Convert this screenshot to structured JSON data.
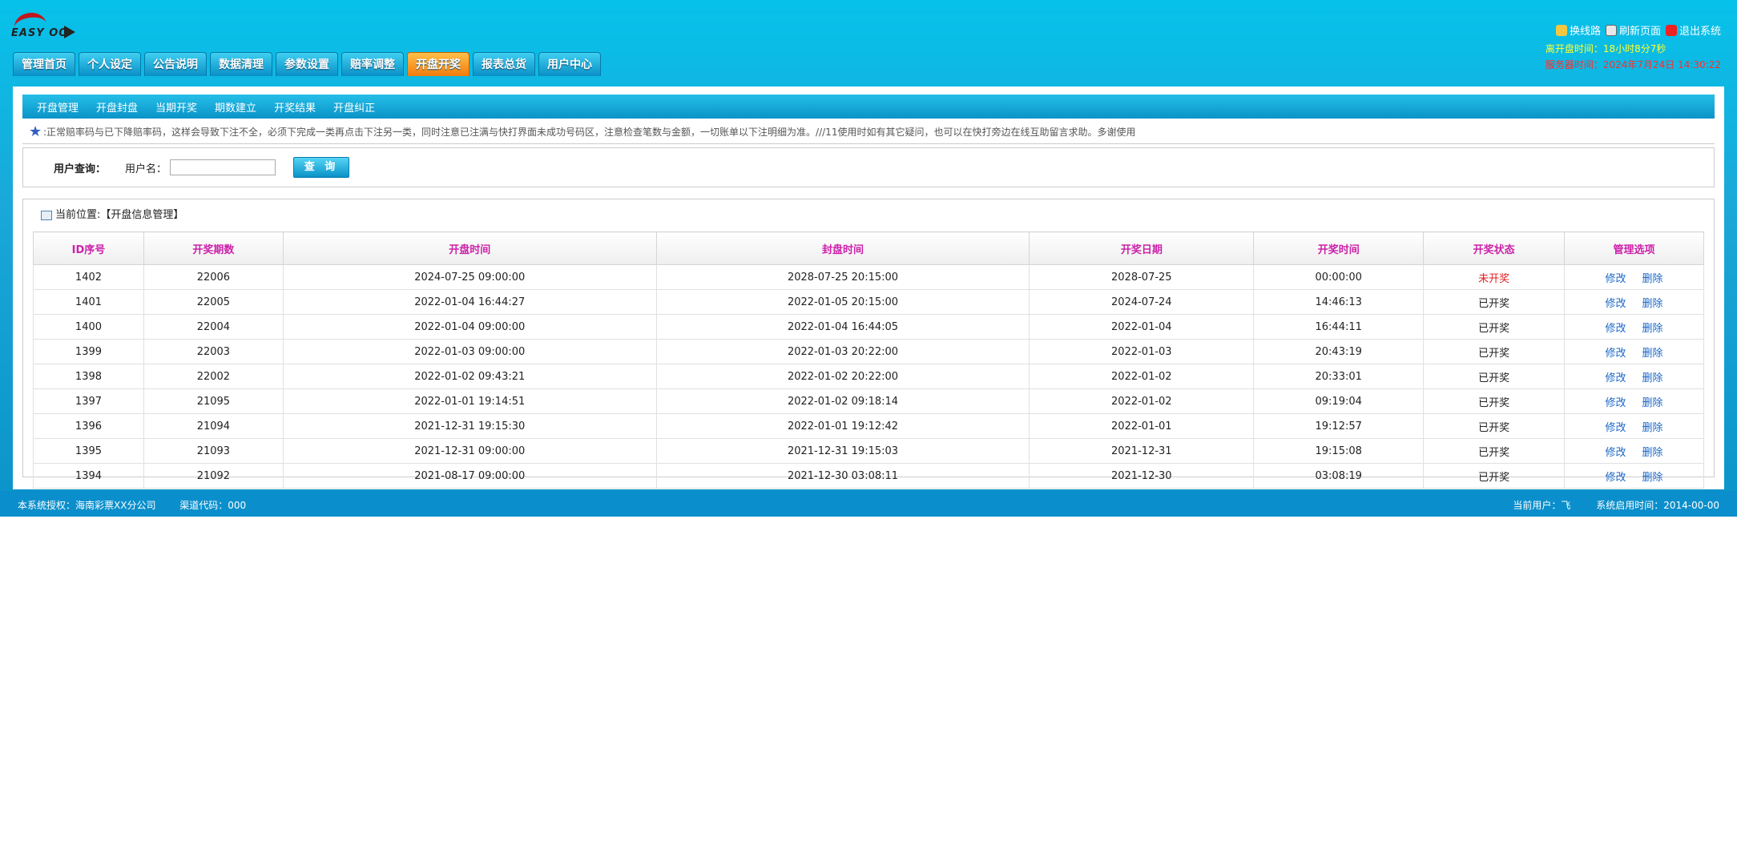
{
  "logo": {
    "text": "EASY OO"
  },
  "nav": {
    "tabs": [
      {
        "label": "管理首页",
        "active": false
      },
      {
        "label": "个人设定",
        "active": false
      },
      {
        "label": "公告说明",
        "active": false
      },
      {
        "label": "数据清理",
        "active": false
      },
      {
        "label": "参数设置",
        "active": false
      },
      {
        "label": "赔率调整",
        "active": false
      },
      {
        "label": "开盘开奖",
        "active": true
      },
      {
        "label": "报表总货",
        "active": false
      },
      {
        "label": "用户中心",
        "active": false
      }
    ]
  },
  "top_links": {
    "swap_line": "换线路",
    "refresh": "刷新页面",
    "logout": "退出系统",
    "timer": "离开盘时间：18小时8分7秒",
    "server_time": "服务器时间：2024年7月24日 14:30:22"
  },
  "subnav": {
    "items": [
      "开盘管理",
      "开盘封盘",
      "当期开奖",
      "期数建立",
      "开奖结果",
      "开盘纠正"
    ]
  },
  "notice": {
    "text": ":正常赔率码与已下降赔率码，这样会导致下注不全，必须下完成一类再点击下注另一类，同时注意已注满与快打界面未成功号码区，注意检查笔数与金额，一切账单以下注明细为准。///11使用时如有其它疑问，也可以在快打旁边在线互助留言求助。多谢使用"
  },
  "search": {
    "title": "用户查询：",
    "username_label": "用户名：",
    "username_value": "",
    "button_label": "查 询"
  },
  "location": {
    "text": "当前位置:【开盘信息管理】"
  },
  "table": {
    "headers": [
      "ID序号",
      "开奖期数",
      "开盘时间",
      "封盘时间",
      "开奖日期",
      "开奖时间",
      "开奖状态",
      "管理选项"
    ],
    "edit_label": "修改",
    "delete_label": "删除",
    "rows": [
      {
        "id": "1402",
        "period": "22006",
        "open_time": "2024-07-25 09:00:00",
        "close_time": "2028-07-25 20:15:00",
        "draw_date": "2028-07-25",
        "draw_time": "00:00:00",
        "status": "未开奖",
        "opened": false
      },
      {
        "id": "1401",
        "period": "22005",
        "open_time": "2022-01-04 16:44:27",
        "close_time": "2022-01-05 20:15:00",
        "draw_date": "2024-07-24",
        "draw_time": "14:46:13",
        "status": "已开奖",
        "opened": true
      },
      {
        "id": "1400",
        "period": "22004",
        "open_time": "2022-01-04 09:00:00",
        "close_time": "2022-01-04 16:44:05",
        "draw_date": "2022-01-04",
        "draw_time": "16:44:11",
        "status": "已开奖",
        "opened": true
      },
      {
        "id": "1399",
        "period": "22003",
        "open_time": "2022-01-03 09:00:00",
        "close_time": "2022-01-03 20:22:00",
        "draw_date": "2022-01-03",
        "draw_time": "20:43:19",
        "status": "已开奖",
        "opened": true
      },
      {
        "id": "1398",
        "period": "22002",
        "open_time": "2022-01-02 09:43:21",
        "close_time": "2022-01-02 20:22:00",
        "draw_date": "2022-01-02",
        "draw_time": "20:33:01",
        "status": "已开奖",
        "opened": true
      },
      {
        "id": "1397",
        "period": "21095",
        "open_time": "2022-01-01 19:14:51",
        "close_time": "2022-01-02 09:18:14",
        "draw_date": "2022-01-02",
        "draw_time": "09:19:04",
        "status": "已开奖",
        "opened": true
      },
      {
        "id": "1396",
        "period": "21094",
        "open_time": "2021-12-31 19:15:30",
        "close_time": "2022-01-01 19:12:42",
        "draw_date": "2022-01-01",
        "draw_time": "19:12:57",
        "status": "已开奖",
        "opened": true
      },
      {
        "id": "1395",
        "period": "21093",
        "open_time": "2021-12-31 09:00:00",
        "close_time": "2021-12-31 19:15:03",
        "draw_date": "2021-12-31",
        "draw_time": "19:15:08",
        "status": "已开奖",
        "opened": true
      },
      {
        "id": "1394",
        "period": "21092",
        "open_time": "2021-08-17 09:00:00",
        "close_time": "2021-12-30 03:08:11",
        "draw_date": "2021-12-30",
        "draw_time": "03:08:19",
        "status": "已开奖",
        "opened": true
      }
    ]
  },
  "footer": {
    "license": "本系统授权：海南彩票XX分公司",
    "channel": "渠道代码：000",
    "current_user": "当前用户：飞",
    "start_time": "系统启用时间：2014-00-00"
  }
}
